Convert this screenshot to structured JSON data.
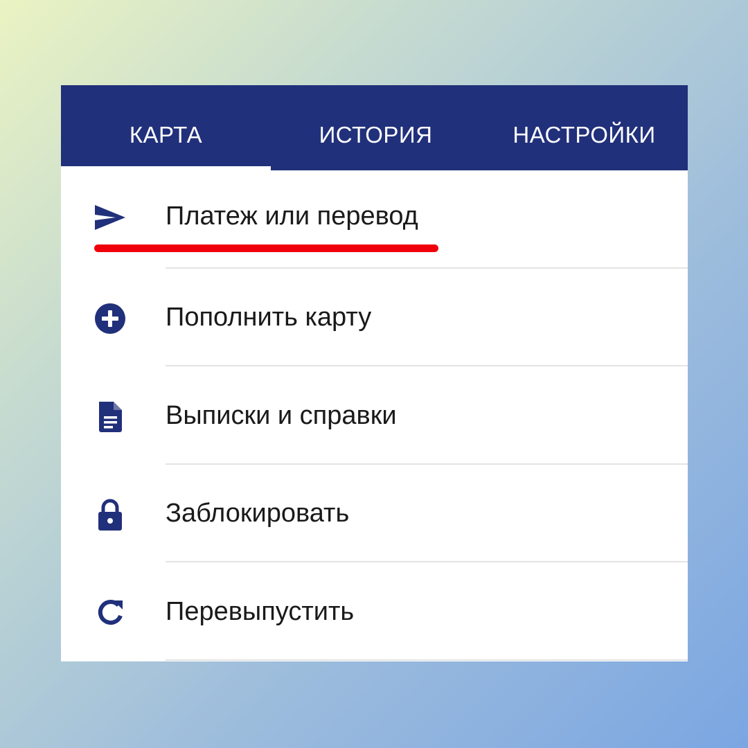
{
  "tabs": [
    {
      "label": "КАРТА",
      "active": true
    },
    {
      "label": "ИСТОРИЯ",
      "active": false
    },
    {
      "label": "НАСТРОЙКИ",
      "active": false
    }
  ],
  "menu": [
    {
      "label": "Платеж или перевод",
      "icon": "send-icon"
    },
    {
      "label": "Пополнить карту",
      "icon": "plus-circle-icon"
    },
    {
      "label": "Выписки и справки",
      "icon": "document-icon"
    },
    {
      "label": "Заблокировать",
      "icon": "lock-icon"
    },
    {
      "label": "Перевыпустить",
      "icon": "refresh-icon"
    }
  ],
  "colors": {
    "header_background": "#21307a",
    "icon_color": "#21307a",
    "highlight_underline": "#f0000a",
    "background_gradient": [
      "#eaf3c2",
      "#7ba6e2"
    ]
  }
}
